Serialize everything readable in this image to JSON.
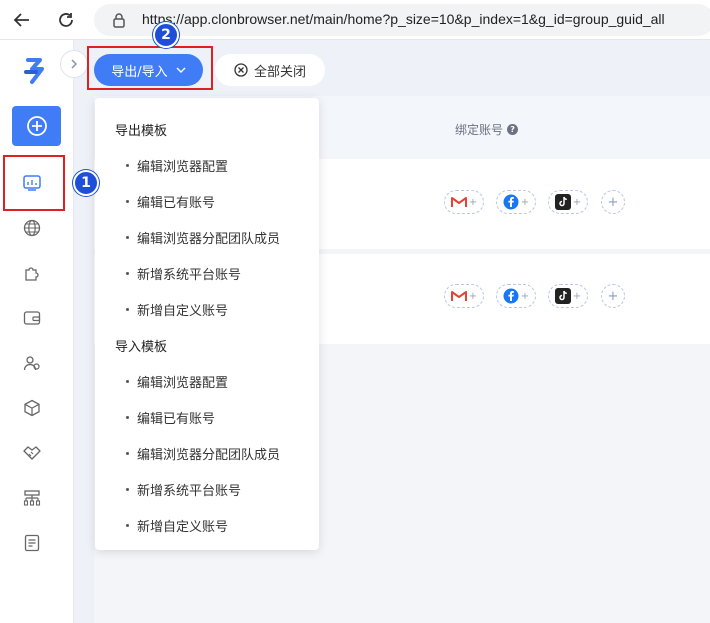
{
  "browser": {
    "url": "https://app.clonbrowser.net/main/home?p_size=10&p_index=1&g_id=group_guid_all"
  },
  "toolbar": {
    "export_label": "导出/导入",
    "close_all_label": "全部关闭"
  },
  "table": {
    "bind_accounts_header": "绑定账号"
  },
  "dropdown": {
    "export_group": "导出模板",
    "export_items": [
      "编辑浏览器配置",
      "编辑已有账号",
      "编辑浏览器分配团队成员",
      "新增系统平台账号",
      "新增自定义账号"
    ],
    "import_group": "导入模板",
    "import_items": [
      "编辑浏览器配置",
      "编辑已有账号",
      "编辑浏览器分配团队成员",
      "新增系统平台账号",
      "新增自定义账号"
    ]
  },
  "annotations": {
    "badge1": "1",
    "badge2": "2",
    "highlight_color": "#e02020",
    "badge_color": "#1d4fd8"
  },
  "colors": {
    "accent": "#3f7cf6"
  },
  "icons": {
    "sidebar": [
      "browser-window-icon",
      "globe-icon",
      "puzzle-icon",
      "wallet-icon",
      "users-icon",
      "cube-icon",
      "handshake-icon",
      "org-chart-icon",
      "report-icon"
    ]
  }
}
